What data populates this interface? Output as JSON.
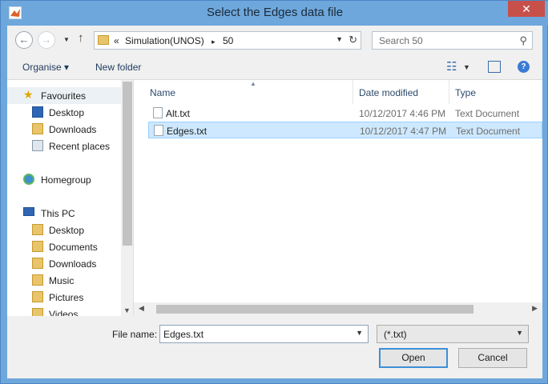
{
  "window": {
    "title": "Select the Edges data file",
    "close_label": "✕"
  },
  "address": {
    "path_prefix": "«",
    "path_segment": "Simulation(UNOS)",
    "separator": "▸",
    "path_current": "50"
  },
  "search": {
    "placeholder": "Search 50"
  },
  "toolbar": {
    "organise_label": "Organise ▾",
    "new_folder_label": "New folder"
  },
  "nav": {
    "items": [
      {
        "label": "Favourites"
      },
      {
        "label": "Desktop"
      },
      {
        "label": "Downloads"
      },
      {
        "label": "Recent places"
      },
      {
        "label": "Homegroup"
      },
      {
        "label": "This PC"
      },
      {
        "label": "Desktop"
      },
      {
        "label": "Documents"
      },
      {
        "label": "Downloads"
      },
      {
        "label": "Music"
      },
      {
        "label": "Pictures"
      },
      {
        "label": "Videos"
      }
    ]
  },
  "columns": {
    "name": "Name",
    "date": "Date modified",
    "type": "Type"
  },
  "files": [
    {
      "name": "Alt.txt",
      "date": "10/12/2017 4:46 PM",
      "type": "Text Document"
    },
    {
      "name": "Edges.txt",
      "date": "10/12/2017 4:47 PM",
      "type": "Text Document"
    }
  ],
  "footer": {
    "file_name_label": "File name:",
    "file_name_value": "Edges.txt",
    "filter_value": "(*.txt)",
    "open_label": "Open",
    "cancel_label": "Cancel"
  },
  "colors": {
    "titlebar": "#6ea7db",
    "selection": "#cde8ff",
    "accent": "#3c8fd6"
  }
}
